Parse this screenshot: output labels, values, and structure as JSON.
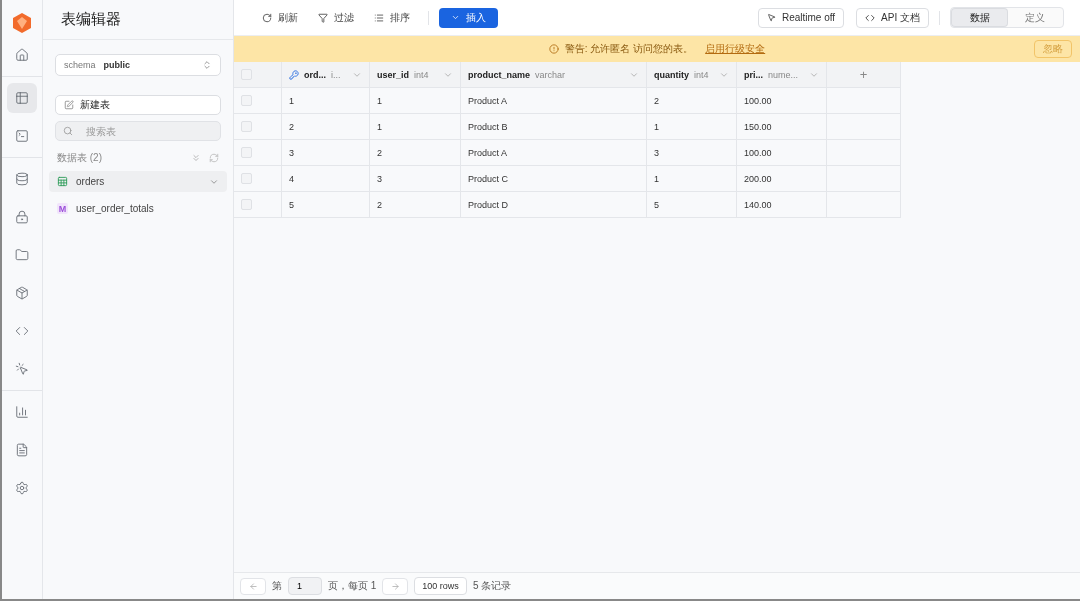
{
  "rail": {
    "groups": [
      [
        {
          "selected": false
        }
      ],
      [
        {
          "selected": true
        },
        {
          "selected": false
        }
      ],
      [
        {
          "selected": false
        },
        {
          "selected": false
        },
        {
          "selected": false
        },
        {
          "selected": false
        },
        {
          "selected": false
        },
        {
          "selected": false
        }
      ],
      [
        {
          "selected": false
        },
        {
          "selected": false
        },
        {
          "selected": false
        }
      ]
    ]
  },
  "sidebar": {
    "title": "表编辑器",
    "schema": {
      "label": "schema",
      "value": "public"
    },
    "new_table": "新建表",
    "search": {
      "placeholder": "搜索表"
    },
    "section": "数据表 (2)",
    "tables": [
      {
        "kind": "table",
        "name": "orders",
        "selected": true
      },
      {
        "kind": "view",
        "badge": "M",
        "name": "user_order_totals",
        "selected": false
      }
    ]
  },
  "toolbar": {
    "refresh": "刷新",
    "filter": "过滤",
    "sort": "排序",
    "insert": "插入",
    "realtime": "Realtime off",
    "api_docs": "API 文档",
    "views": [
      {
        "label": "数据",
        "selected": true
      },
      {
        "label": "定义",
        "selected": false
      }
    ]
  },
  "banner": {
    "text": "警告: 允许匿名 访问您的表。",
    "link": "启用行级安全",
    "dismiss": "忽略"
  },
  "table": {
    "select_all": false,
    "columns": [
      {
        "name": "ord...",
        "type": "i...",
        "primary_key": true
      },
      {
        "name": "user_id",
        "type": "int4",
        "primary_key": false
      },
      {
        "name": "product_name",
        "type": "varchar",
        "primary_key": false
      },
      {
        "name": "quantity",
        "type": "int4",
        "primary_key": false
      },
      {
        "name": "pri...",
        "type": "nume...",
        "primary_key": false
      }
    ],
    "add_column": "+",
    "rows": [
      {
        "selected": false,
        "cells": [
          "1",
          "1",
          "Product A",
          "2",
          "100.00"
        ]
      },
      {
        "selected": false,
        "cells": [
          "2",
          "1",
          "Product B",
          "1",
          "150.00"
        ]
      },
      {
        "selected": false,
        "cells": [
          "3",
          "2",
          "Product A",
          "3",
          "100.00"
        ]
      },
      {
        "selected": false,
        "cells": [
          "4",
          "3",
          "Product C",
          "1",
          "200.00"
        ]
      },
      {
        "selected": false,
        "cells": [
          "5",
          "2",
          "Product D",
          "5",
          "140.00"
        ]
      }
    ]
  },
  "footer": {
    "page_prefix": "第",
    "page": "1",
    "page_suffix": "页，每页 1",
    "page_size": "100 rows",
    "count": "5 条记录"
  }
}
